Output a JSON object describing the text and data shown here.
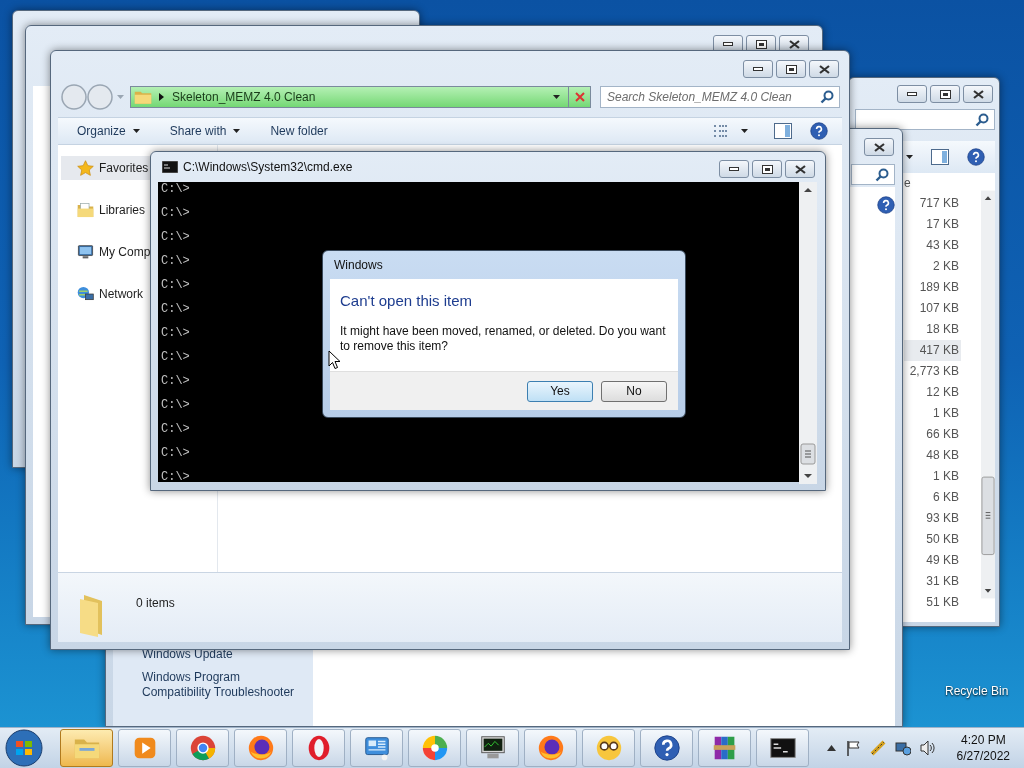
{
  "desktop": {
    "icons": [
      {
        "label": "Recycle Bin"
      }
    ]
  },
  "explorer": {
    "address": "Skeleton_MEMZ 4.0 Clean",
    "search": {
      "placeholder": "Search Skeleton_MEMZ 4.0 Clean"
    },
    "toolbar": [
      {
        "label": "Organize",
        "dropdown": true
      },
      {
        "label": "Share with",
        "dropdown": true
      },
      {
        "label": "New folder",
        "dropdown": false
      }
    ],
    "nav": [
      {
        "kind": "favorites",
        "label": "Favorites",
        "selected": true
      },
      {
        "kind": "libraries",
        "label": "Libraries",
        "selected": false
      },
      {
        "kind": "computer",
        "label": "My Comp",
        "selected": false
      },
      {
        "kind": "network",
        "label": "Network",
        "selected": false
      }
    ],
    "status": "0 items"
  },
  "files_window": {
    "column_header": "e",
    "sizes": [
      {
        "text": "717 KB",
        "selected": false
      },
      {
        "text": "17 KB",
        "selected": false
      },
      {
        "text": "43 KB",
        "selected": false
      },
      {
        "text": "2 KB",
        "selected": false
      },
      {
        "text": "189 KB",
        "selected": false
      },
      {
        "text": "107 KB",
        "selected": false
      },
      {
        "text": "18 KB",
        "selected": false
      },
      {
        "text": "417 KB",
        "selected": true
      },
      {
        "text": "2,773 KB",
        "selected": false
      },
      {
        "text": "12 KB",
        "selected": false
      },
      {
        "text": "1 KB",
        "selected": false
      },
      {
        "text": "66 KB",
        "selected": false
      },
      {
        "text": "48 KB",
        "selected": false
      },
      {
        "text": "1 KB",
        "selected": false
      },
      {
        "text": "6 KB",
        "selected": false
      },
      {
        "text": "93 KB",
        "selected": false
      },
      {
        "text": "50 KB",
        "selected": false
      },
      {
        "text": "49 KB",
        "selected": false
      },
      {
        "text": "31 KB",
        "selected": false
      },
      {
        "text": "51 KB",
        "selected": false
      }
    ]
  },
  "control_panel": {
    "links": [
      "Windows Update",
      "Windows Program Compatibility Troubleshooter"
    ]
  },
  "cmd": {
    "title": "C:\\Windows\\System32\\cmd.exe",
    "lines": [
      "C:\\>",
      "C:\\>",
      "C:\\>",
      "C:\\>",
      "C:\\>",
      "C:\\>",
      "C:\\>",
      "C:\\>",
      "C:\\>",
      "C:\\>",
      "C:\\>",
      "C:\\>",
      "C:\\>"
    ]
  },
  "dialog": {
    "title": "Windows",
    "heading": "Can't open this item",
    "message": "It might have been moved, renamed, or deleted. Do you want to remove this item?",
    "buttons": [
      {
        "label": "Yes",
        "selected": true
      },
      {
        "label": "No",
        "selected": false
      }
    ]
  },
  "taskbar": {
    "apps": [
      {
        "kind": "explorer",
        "selected": true
      },
      {
        "kind": "media_player",
        "selected": false
      },
      {
        "kind": "chrome",
        "selected": false
      },
      {
        "kind": "firefox",
        "selected": false
      },
      {
        "kind": "opera",
        "selected": false
      },
      {
        "kind": "control_panel",
        "selected": false
      },
      {
        "kind": "picasa",
        "selected": false
      },
      {
        "kind": "task_monitor",
        "selected": false
      },
      {
        "kind": "firefox",
        "selected": false
      },
      {
        "kind": "nerd_face",
        "selected": false
      },
      {
        "kind": "help",
        "selected": false
      },
      {
        "kind": "archiver",
        "selected": false
      },
      {
        "kind": "cmd",
        "selected": false
      }
    ],
    "clock": {
      "time": "4:20 PM",
      "date": "6/27/2022"
    }
  }
}
